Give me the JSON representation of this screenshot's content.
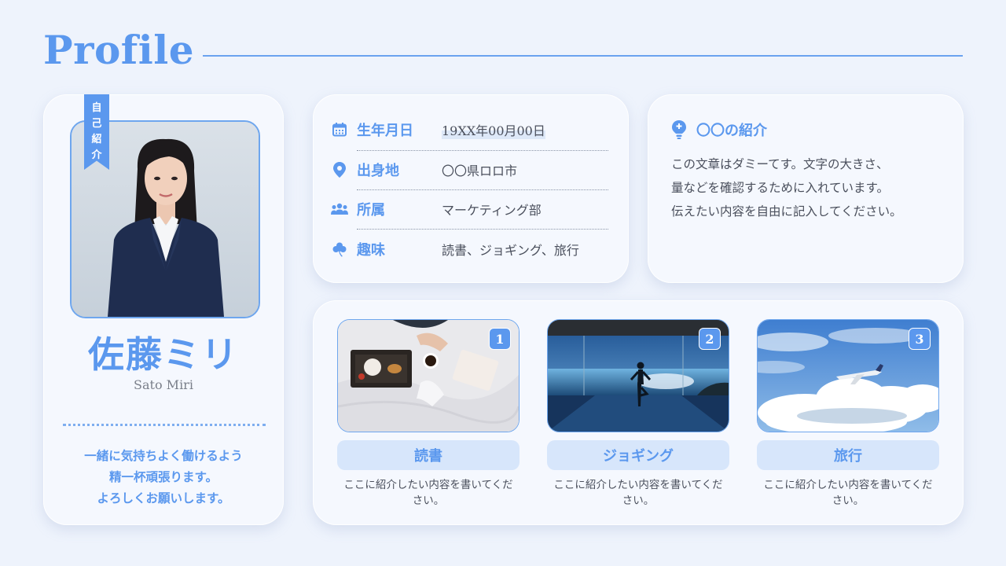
{
  "title": "Profile",
  "profile": {
    "ribbon_label": [
      "自",
      "己",
      "紹",
      "介"
    ],
    "name_jp": "佐藤ミリ",
    "name_en": "Sato Miri",
    "greeting": [
      "一緒に気持ちよく働けるよう",
      "精一杯頑張ります。",
      "よろしくお願いします。"
    ]
  },
  "info": {
    "rows": [
      {
        "label": "生年月日",
        "value": "19XX年00月00日",
        "icon": "calendar-icon"
      },
      {
        "label": "出身地",
        "value": "〇〇県ロロ市",
        "icon": "location-pin-icon"
      },
      {
        "label": "所属",
        "value": "マーケティング部",
        "icon": "group-icon"
      },
      {
        "label": "趣味",
        "value": "読書、ジョギング、旅行",
        "icon": "clover-icon"
      }
    ]
  },
  "intro": {
    "heading": "〇〇の紹介",
    "icon": "lightbulb-pin-icon",
    "lines": [
      "この文章はダミーてす。文字の大きさ、",
      "量などを確認するために入れています。",
      "伝えたい内容を自由に記入してください。"
    ]
  },
  "hobbies": [
    {
      "num": "1",
      "label": "読書",
      "desc": "ここに紹介したい内容を書いてください。"
    },
    {
      "num": "2",
      "label": "ジョギング",
      "desc": "ここに紹介したい内容を書いてください。"
    },
    {
      "num": "3",
      "label": "旅行",
      "desc": "ここに紹介したい内容を書いてください。"
    }
  ],
  "colors": {
    "accent": "#5b98ee",
    "background": "#eef3fc",
    "card": "#f5f8fe",
    "label_bg": "#d7e6fb"
  }
}
